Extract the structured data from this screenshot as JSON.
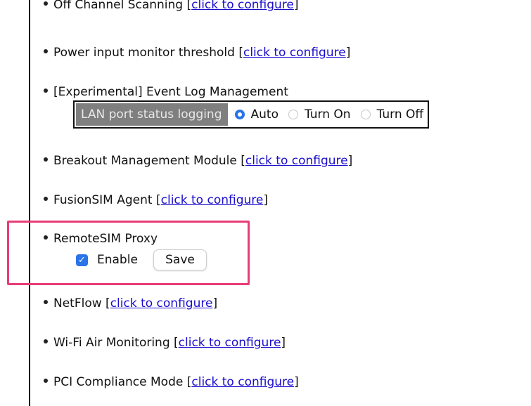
{
  "left_items": [
    {
      "label": "Off Channel Scanning",
      "link": "click to configure"
    },
    {
      "label": "Power input monitor threshold",
      "link": "click to configure"
    }
  ],
  "event_log": {
    "label": "[Experimental] Event Log Management",
    "lan_label": "LAN port status logging",
    "options": [
      {
        "label": "Auto",
        "selected": true
      },
      {
        "label": "Turn On",
        "selected": false
      },
      {
        "label": "Turn Off",
        "selected": false
      }
    ]
  },
  "items_mid": [
    {
      "label": "Breakout Management Module",
      "link": "click to configure"
    },
    {
      "label": "FusionSIM Agent",
      "link": "click to configure"
    }
  ],
  "remotesim": {
    "label": "RemoteSIM Proxy",
    "enable_label": "Enable",
    "enabled": true,
    "save_label": "Save",
    "highlight_color": "#e83c77"
  },
  "items_bottom": [
    {
      "label": "NetFlow",
      "link": "click to configure"
    },
    {
      "label": "Wi-Fi Air Monitoring",
      "link": "click to configure"
    },
    {
      "label": "PCI Compliance Mode",
      "link": "click to configure"
    }
  ],
  "colors": {
    "link": "#1a0dcc",
    "radio_selected": "#2a73e8",
    "lan_label_bg": "#7f7f7f"
  }
}
